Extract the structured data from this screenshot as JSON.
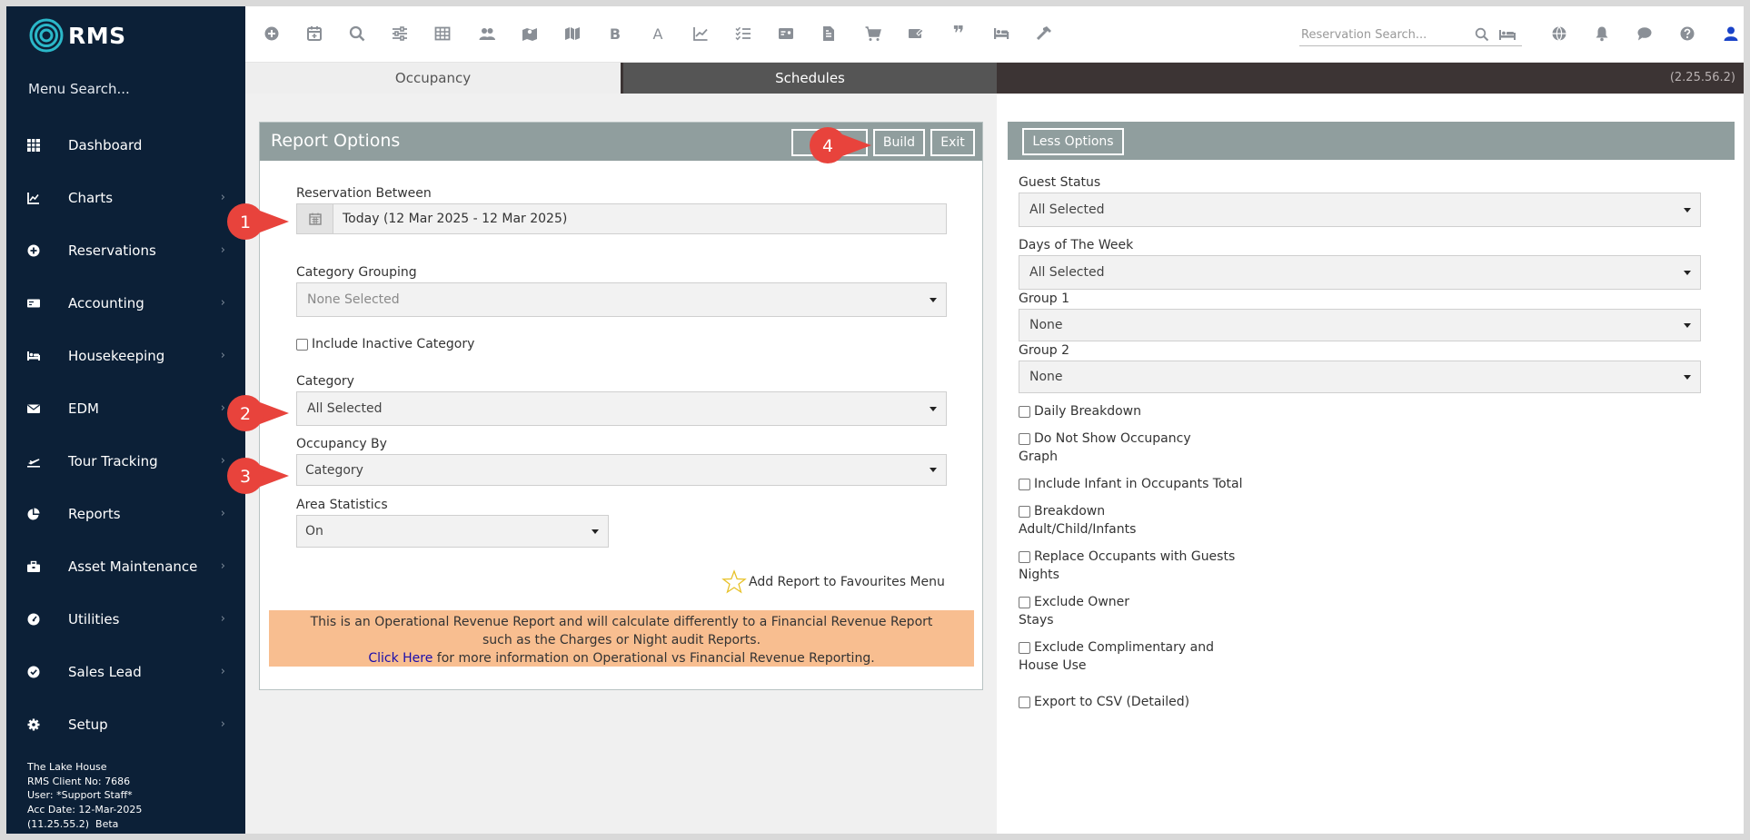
{
  "app": {
    "logo_text": "RMS",
    "menu_search": "Menu Search...",
    "property_info": {
      "name": "The Lake House",
      "client_no": "RMS Client No: 7686",
      "user": "User: *Support Staff*",
      "acc_date": "Acc Date: 12-Mar-2025",
      "version_line": "(11.25.55.2)  Beta"
    }
  },
  "sidebar": {
    "items": [
      {
        "label": "Dashboard",
        "icon": "grid-icon",
        "chevron": false
      },
      {
        "label": "Charts",
        "icon": "chart-icon",
        "chevron": true
      },
      {
        "label": "Reservations",
        "icon": "plus-circle-icon",
        "chevron": true
      },
      {
        "label": "Accounting",
        "icon": "money-icon",
        "chevron": true
      },
      {
        "label": "Housekeeping",
        "icon": "bed-icon",
        "chevron": true
      },
      {
        "label": "EDM",
        "icon": "envelope-icon",
        "chevron": true
      },
      {
        "label": "Tour Tracking",
        "icon": "plane-icon",
        "chevron": true
      },
      {
        "label": "Reports",
        "icon": "pie-chart-icon",
        "chevron": true
      },
      {
        "label": "Asset Maintenance",
        "icon": "toolbox-icon",
        "chevron": true
      },
      {
        "label": "Utilities",
        "icon": "gauge-icon",
        "chevron": true
      },
      {
        "label": "Sales Lead",
        "icon": "check-circle-icon",
        "chevron": true
      },
      {
        "label": "Setup",
        "icon": "gear-icon",
        "chevron": true
      }
    ]
  },
  "toolbar": {
    "bold_glyph": "B",
    "font_glyph": "A",
    "quote_glyph": "❞",
    "reservation_search_placeholder": "Reservation Search..."
  },
  "tabs": {
    "occupancy": "Occupancy",
    "schedules": "Schedules",
    "version": "(2.25.56.2)"
  },
  "report_options": {
    "title": "Report Options",
    "save_label": "Save",
    "build_label": "Build",
    "exit_label": "Exit",
    "reservation_between_label": "Reservation Between",
    "reservation_between_value": "Today (12 Mar 2025 - 12 Mar 2025)",
    "category_grouping_label": "Category Grouping",
    "category_grouping_value": "None Selected",
    "include_inactive_label": "Include Inactive Category",
    "category_label": "Category",
    "category_value": "All Selected",
    "occupancy_by_label": "Occupancy By",
    "occupancy_by_value": "Category",
    "area_statistics_label": "Area Statistics",
    "area_statistics_value": "On",
    "favourites_label": "Add Report to Favourites Menu",
    "notice_line1": "This is an Operational Revenue Report and will calculate differently to a Financial Revenue Report",
    "notice_line2": "such as the Charges or Night audit Reports.",
    "notice_link": "Click Here",
    "notice_line3": " for more information on Operational vs Financial Revenue Reporting."
  },
  "more_options": {
    "less_options_label": "Less Options",
    "guest_status_label": "Guest Status",
    "guest_status_value": "All Selected",
    "days_of_week_label": "Days of The Week",
    "days_of_week_value": "All Selected",
    "group1_label": "Group 1",
    "group1_value": "None",
    "group2_label": "Group 2",
    "group2_value": "None",
    "checkboxes": [
      {
        "line1": "Daily Breakdown",
        "line2": ""
      },
      {
        "line1": "Do Not Show Occupancy",
        "line2": "Graph"
      },
      {
        "line1": "Include Infant in Occupants Total",
        "line2": ""
      },
      {
        "line1": "Breakdown",
        "line2": "Adult/Child/Infants"
      },
      {
        "line1": "Replace Occupants with Guests",
        "line2": "Nights"
      },
      {
        "line1": "Exclude Owner",
        "line2": "Stays"
      },
      {
        "line1": "Exclude Complimentary and",
        "line2": "House Use"
      },
      {
        "line1": "Export to CSV (Detailed)",
        "line2": ""
      }
    ]
  },
  "callouts": [
    "1",
    "2",
    "3",
    "4"
  ],
  "colors": {
    "sidebar_bg": "#0c2037",
    "panel_header": "#909e9e",
    "tab_bar": "#3c3434",
    "notice_bg": "#f8be90",
    "callout_red": "#e8433c",
    "accent_blue": "#1a43c8"
  }
}
